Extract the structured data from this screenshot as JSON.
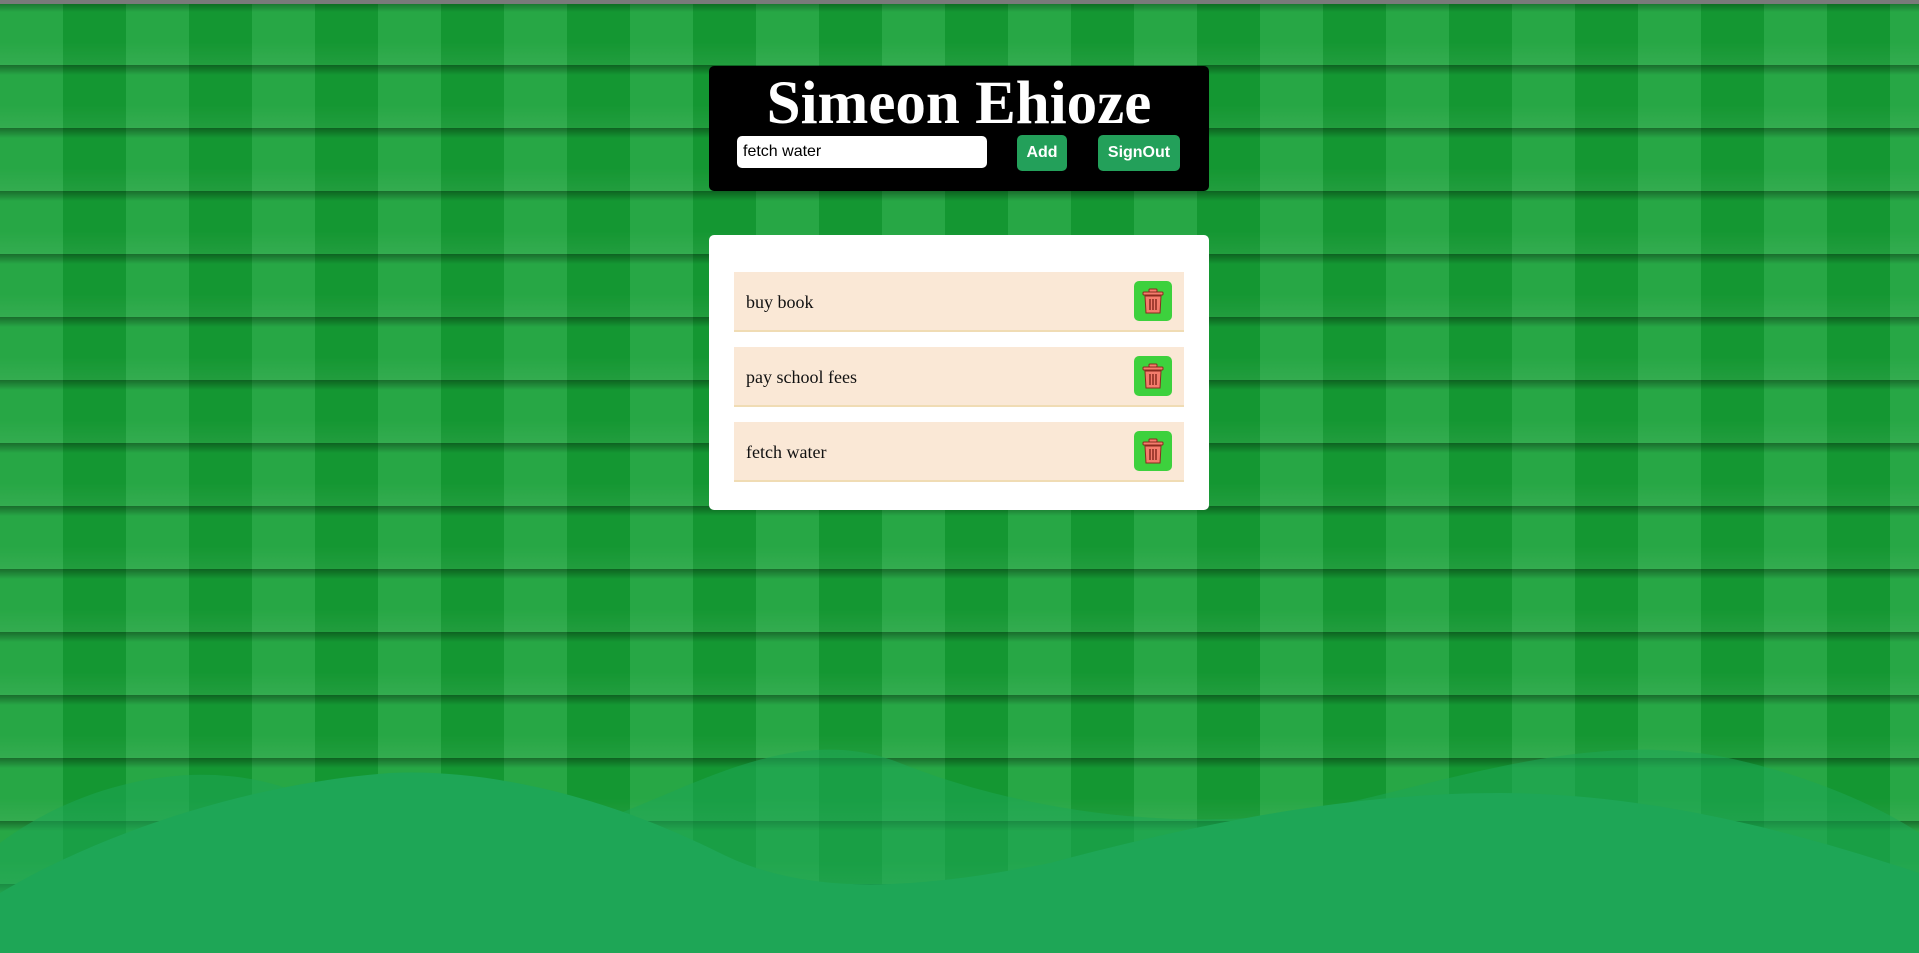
{
  "header": {
    "title": "Simeon Ehioze",
    "input_value": "fetch water",
    "add_label": "Add",
    "signout_label": "SignOut"
  },
  "todos": [
    {
      "text": "buy book",
      "icon": "trash-icon"
    },
    {
      "text": "pay school fees",
      "icon": "trash-icon"
    },
    {
      "text": "fetch water",
      "icon": "trash-icon"
    }
  ],
  "colors": {
    "background": "#15a035",
    "header_bg": "#000000",
    "button": "#23a05a",
    "item_bg": "#fae8d6",
    "delete_button": "#3dd13d",
    "trash_icon": "#f47c6c",
    "hills": "#1ea656"
  }
}
